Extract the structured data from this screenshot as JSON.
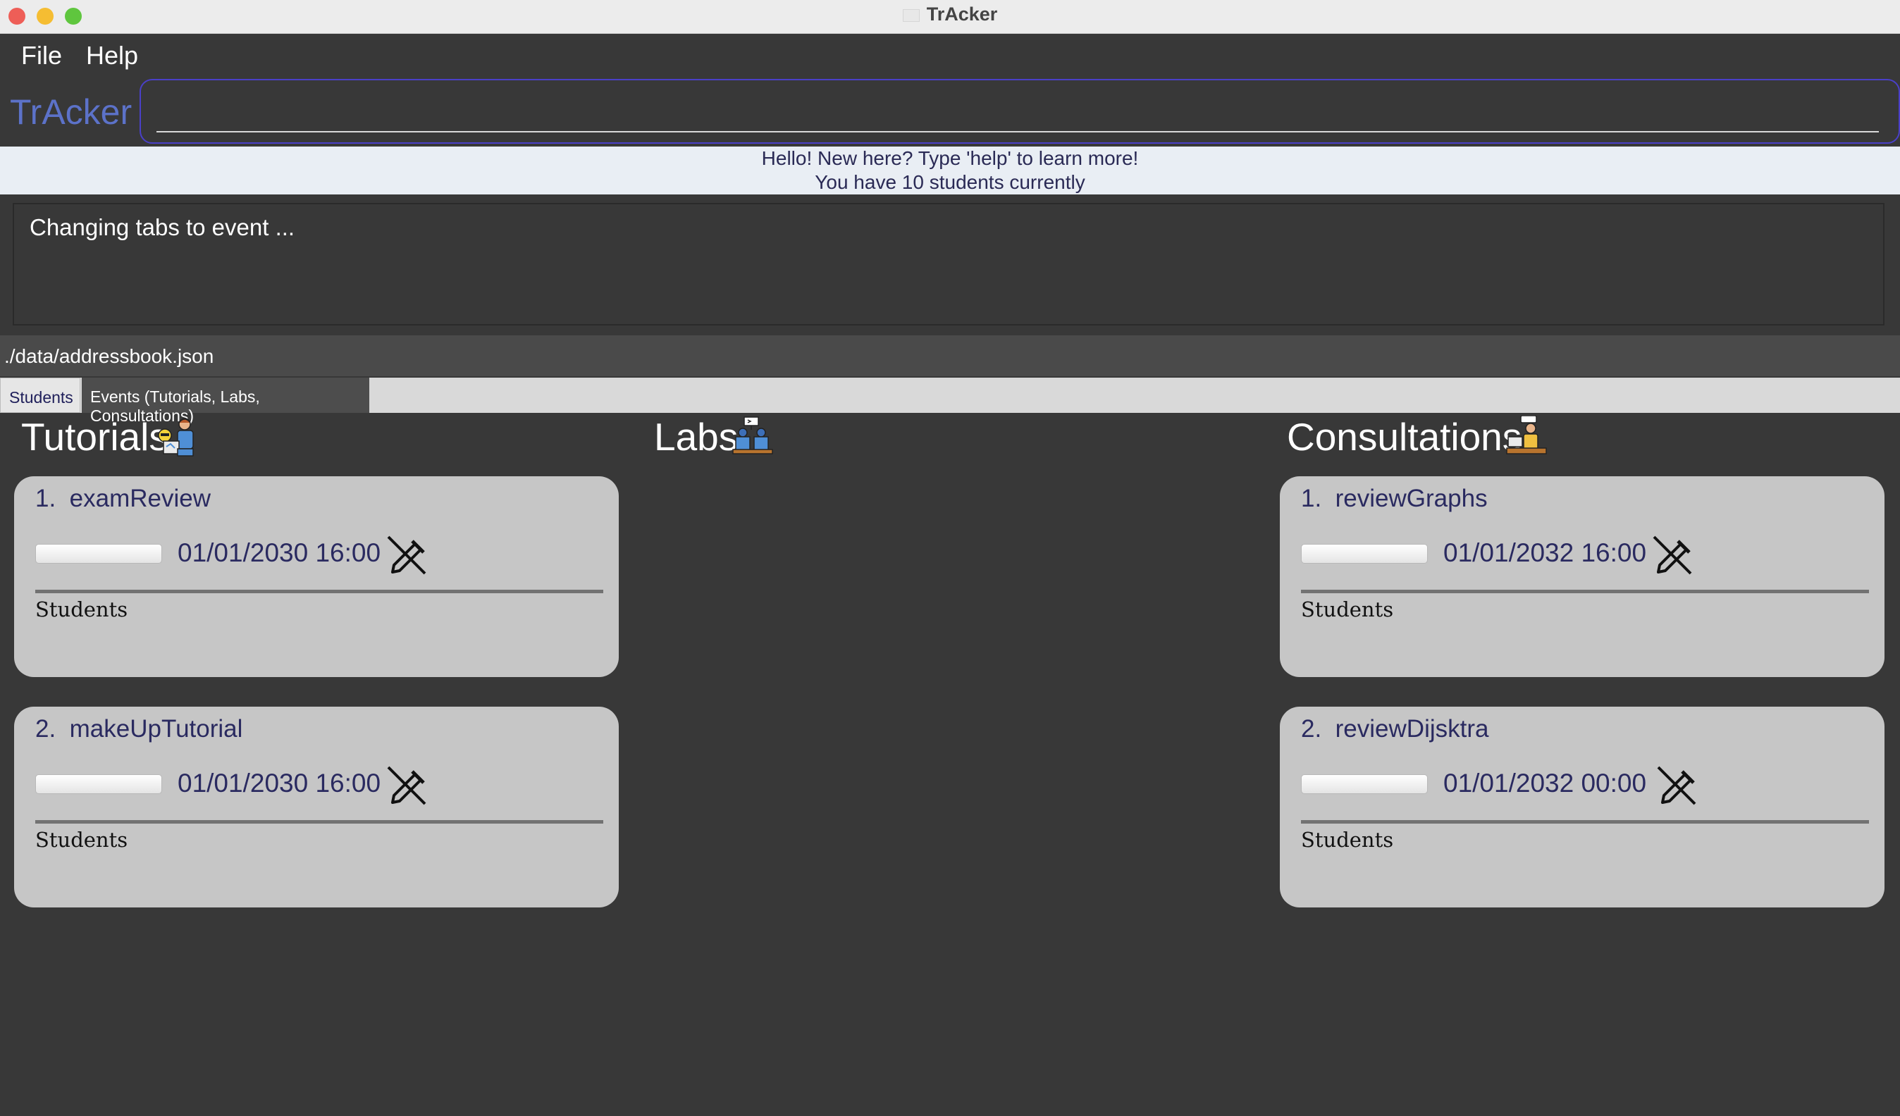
{
  "window": {
    "title": "TrAcker"
  },
  "menu": {
    "items": [
      "File",
      "Help"
    ]
  },
  "brand": "TrAcker",
  "command": {
    "value": "",
    "placeholder": ""
  },
  "banner": {
    "line1": "Hello! New here? Type 'help' to learn more!",
    "line2": "You have 10 students currently"
  },
  "result": {
    "text": "Changing tabs to event ..."
  },
  "status": {
    "path": "./data/addressbook.json"
  },
  "tabs": [
    {
      "label": "Students",
      "selected": false
    },
    {
      "label": "Events (Tutorials, Labs, Consultations)",
      "selected": true
    }
  ],
  "columns": {
    "tutorials": {
      "title": "Tutorials",
      "icon": "tutor-icon",
      "events": [
        {
          "index": "1.",
          "name": "examReview",
          "datetime": "01/01/2030 16:00",
          "students_label": "Students"
        },
        {
          "index": "2.",
          "name": "makeUpTutorial",
          "datetime": "01/01/2030 16:00",
          "students_label": "Students"
        }
      ]
    },
    "labs": {
      "title": "Labs",
      "icon": "lab-icon",
      "events": []
    },
    "consultations": {
      "title": "Consultations",
      "icon": "consultation-icon",
      "events": [
        {
          "index": "1.",
          "name": "reviewGraphs",
          "datetime": "01/01/2032 16:00",
          "students_label": "Students"
        },
        {
          "index": "2.",
          "name": "reviewDijsktra",
          "datetime": "01/01/2032 00:00",
          "students_label": "Students"
        }
      ]
    }
  },
  "colors": {
    "background": "#383838",
    "brand": "#5c72c9",
    "card": "#c6c6c6",
    "text_dark": "#2a2a60",
    "command_border": "#4a40c8"
  }
}
